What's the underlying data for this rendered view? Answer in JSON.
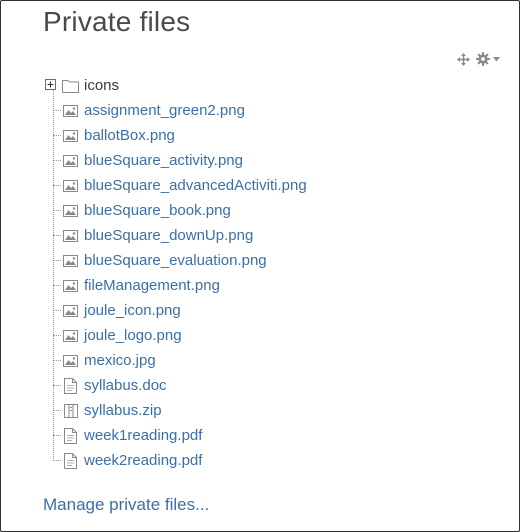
{
  "block": {
    "title": "Private files"
  },
  "controls": {
    "move_icon": "move-icon",
    "actions_icon": "gear-icon",
    "actions_caret": "chevron-down-icon"
  },
  "tree": {
    "folder": {
      "name": "icons",
      "icon": "folder-icon",
      "expander": "plus-expander-icon"
    },
    "files": [
      {
        "name": "assignment_green2.png",
        "icon": "image-file-icon"
      },
      {
        "name": "ballotBox.png",
        "icon": "image-file-icon"
      },
      {
        "name": "blueSquare_activity.png",
        "icon": "image-file-icon"
      },
      {
        "name": "blueSquare_advancedActiviti.png",
        "icon": "image-file-icon"
      },
      {
        "name": "blueSquare_book.png",
        "icon": "image-file-icon"
      },
      {
        "name": "blueSquare_downUp.png",
        "icon": "image-file-icon"
      },
      {
        "name": "blueSquare_evaluation.png",
        "icon": "image-file-icon"
      },
      {
        "name": "fileManagement.png",
        "icon": "image-file-icon"
      },
      {
        "name": "joule_icon.png",
        "icon": "image-file-icon"
      },
      {
        "name": "joule_logo.png",
        "icon": "image-file-icon"
      },
      {
        "name": "mexico.jpg",
        "icon": "image-file-icon"
      },
      {
        "name": "syllabus.doc",
        "icon": "document-file-icon"
      },
      {
        "name": "syllabus.zip",
        "icon": "archive-file-icon"
      },
      {
        "name": "week1reading.pdf",
        "icon": "document-file-icon"
      },
      {
        "name": "week2reading.pdf",
        "icon": "document-file-icon"
      }
    ]
  },
  "footer": {
    "manage_link": "Manage private files..."
  },
  "colors": {
    "link": "#3b6fa8",
    "title": "#4a4a4a",
    "border": "#2f2f2f",
    "icon_gray": "#8a8a8a"
  }
}
